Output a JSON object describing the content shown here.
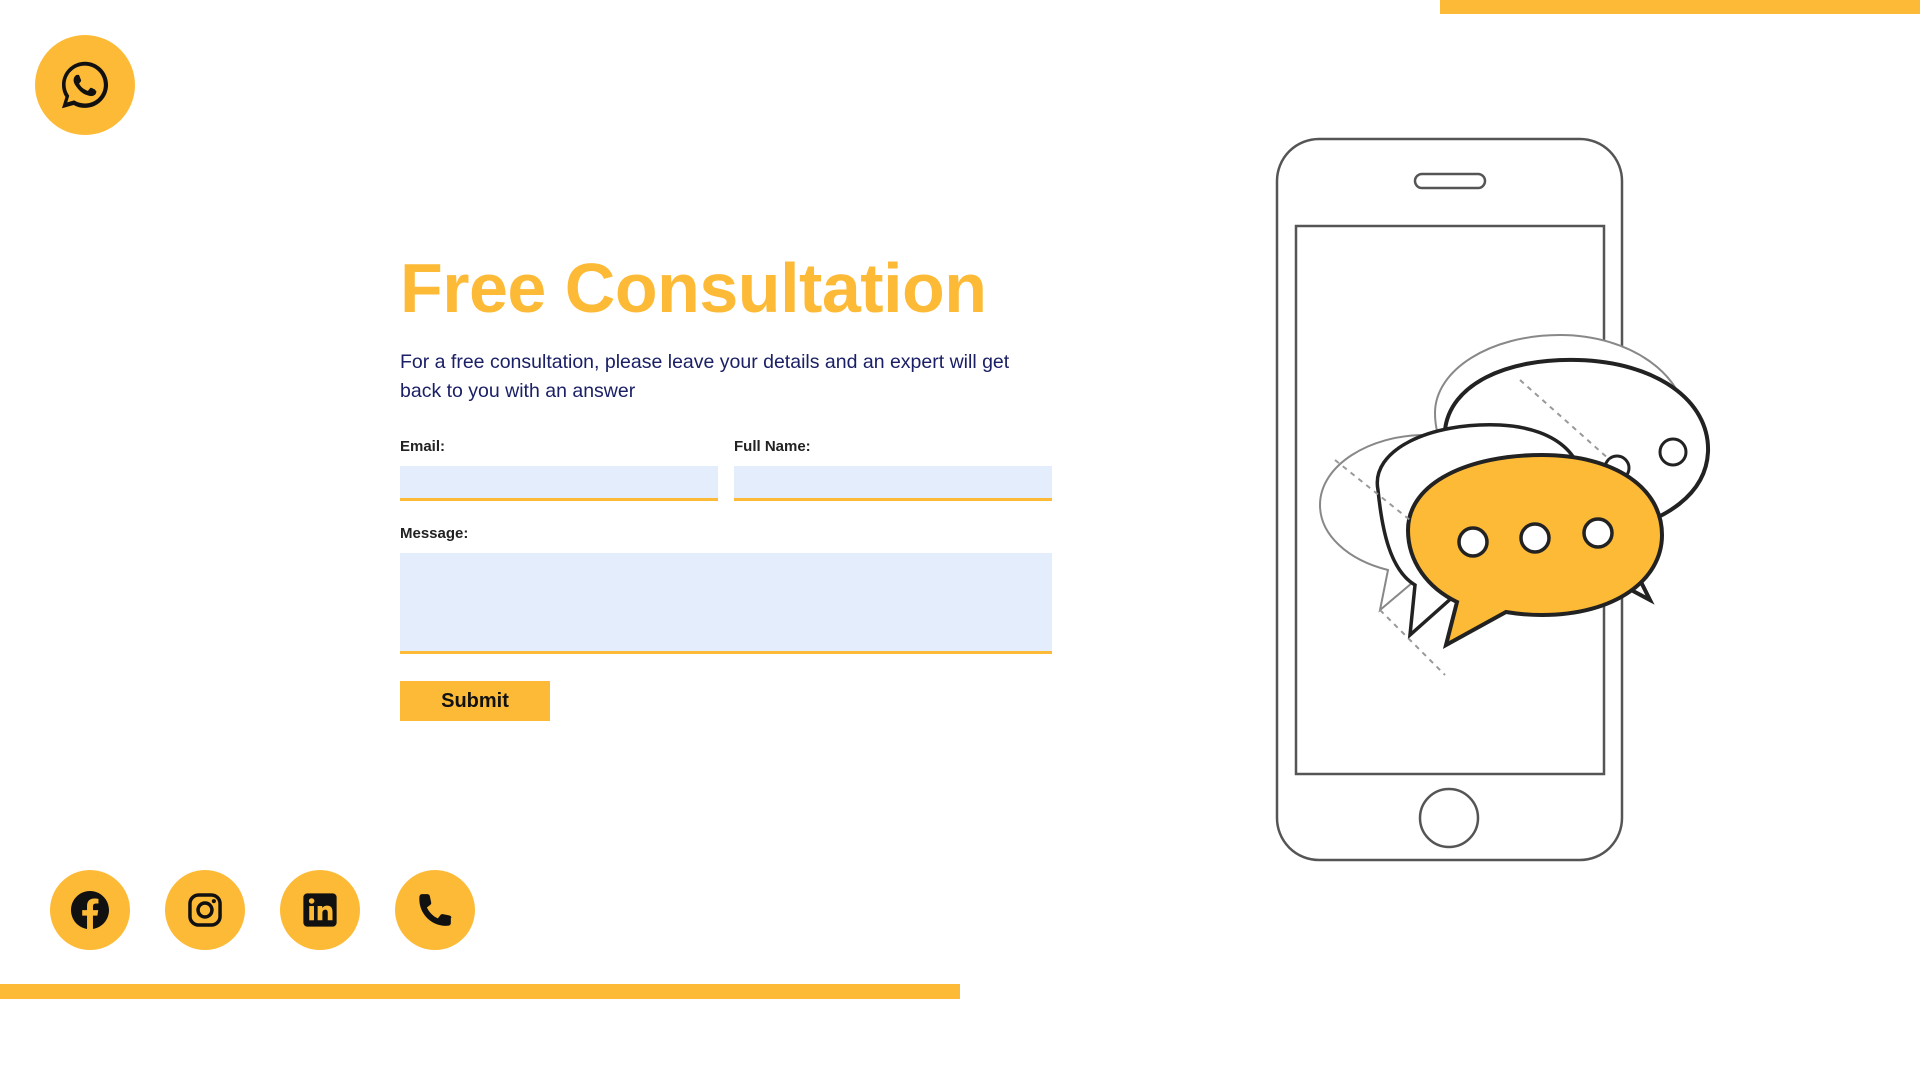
{
  "colors": {
    "accent": "#FDBA37",
    "title": "#FDBA37",
    "text": "#1B2066",
    "input_bg": "#E4EDFC"
  },
  "floating_contact": {
    "icon": "whatsapp-icon"
  },
  "main": {
    "title": "Free Consultation",
    "description": "For a free consultation, please leave your details and an expert will get back to you with an answer"
  },
  "form": {
    "email_label": "Email:",
    "email_value": "",
    "full_name_label": "Full Name:",
    "full_name_value": "",
    "message_label": "Message:",
    "message_value": "",
    "submit_label": "Submit"
  },
  "socials": [
    {
      "icon": "facebook-icon"
    },
    {
      "icon": "instagram-icon"
    },
    {
      "icon": "linkedin-icon"
    },
    {
      "icon": "phone-icon"
    }
  ],
  "illustration": {
    "subject": "phone-with-chat-bubbles"
  }
}
